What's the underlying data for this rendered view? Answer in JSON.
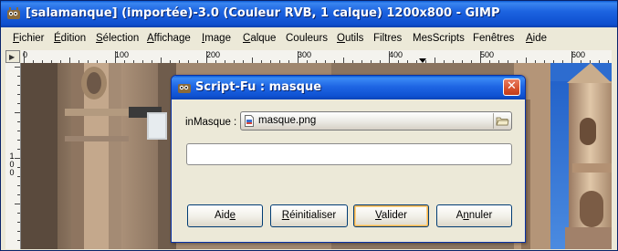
{
  "window": {
    "title": "[salamanque] (importée)-3.0 (Couleur RVB, 1 calque) 1200x800 - GIMP"
  },
  "menubar": {
    "items": [
      {
        "label": "Fichier",
        "u": "F",
        "rest": "ichier"
      },
      {
        "label": "Édition",
        "u": "É",
        "rest": "dition"
      },
      {
        "label": "Sélection",
        "u": "S",
        "rest": "élection"
      },
      {
        "label": "Affichage",
        "u": "A",
        "rest": "ffichage"
      },
      {
        "label": "Image",
        "u": "I",
        "rest": "mage"
      },
      {
        "label": "Calque",
        "u": "C",
        "rest": "alque"
      },
      {
        "label": "Couleurs",
        "u": "",
        "rest": "Couleurs"
      },
      {
        "label": "Outils",
        "u": "O",
        "rest": "utils"
      },
      {
        "label": "Filtres",
        "u": "",
        "rest": "Filtres"
      },
      {
        "label": "MesScripts",
        "u": "",
        "rest": "MesScripts"
      },
      {
        "label": "Fenêtres",
        "u": "",
        "rest": "Fenêtres"
      },
      {
        "label": "Aide",
        "u": "A",
        "rest": "ide"
      }
    ]
  },
  "ruler": {
    "h_labels": [
      "0",
      "100",
      "200",
      "300",
      "400",
      "500",
      "600"
    ],
    "v_labels": [
      "1",
      "0",
      "0"
    ]
  },
  "dialog": {
    "title": "Script-Fu : masque",
    "close_glyph": "✕",
    "field_label": "inMasque :",
    "file_value": "masque.png",
    "progress_text": "",
    "buttons": {
      "help": {
        "pre": "Aid",
        "u": "e",
        "post": ""
      },
      "reset": {
        "pre": "",
        "u": "R",
        "post": "éinitialiser"
      },
      "ok": {
        "pre": "",
        "u": "V",
        "post": "alider"
      },
      "cancel": {
        "pre": "A",
        "u": "n",
        "post": "nuler"
      }
    }
  },
  "icons": {
    "window_icon": "gimp-wilber-icon",
    "dialog_icon": "gimp-wilber-icon",
    "file_icon": "image-file-icon",
    "folder_icon": "folder-open-icon",
    "close_icon": "close-icon"
  },
  "colors": {
    "titlebar": "#1c63e0",
    "close_button": "#d6502c",
    "sky": "#2a6fd6",
    "stone": "#c2a587"
  }
}
